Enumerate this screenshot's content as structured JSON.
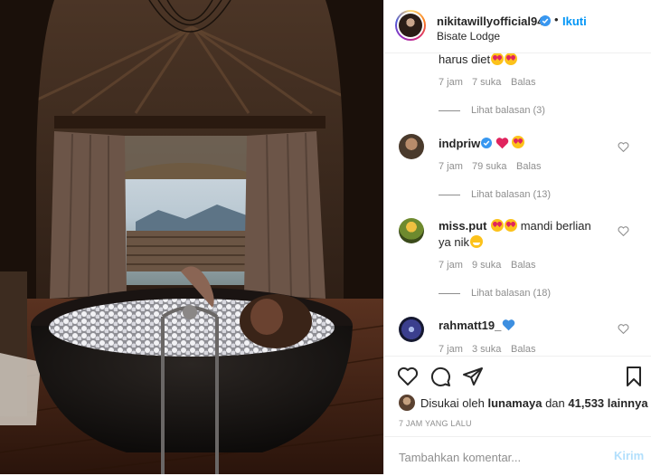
{
  "header": {
    "username": "nikitawillyofficial94",
    "dot": "•",
    "follow_label": "Ikuti",
    "location": "Bisate Lodge"
  },
  "comments": [
    {
      "text": "harus diet",
      "time": "7 jam",
      "likes": "7 suka",
      "reply_label": "Balas",
      "view_replies": "Lihat balasan (3)"
    },
    {
      "username": "indpriw",
      "verified": true,
      "time": "7 jam",
      "likes": "79 suka",
      "reply_label": "Balas",
      "view_replies": "Lihat balasan (13)"
    },
    {
      "username": "miss.put",
      "text": "mandi berlian",
      "text2": "ya nik",
      "time": "7 jam",
      "likes": "9 suka",
      "reply_label": "Balas",
      "view_replies": "Lihat balasan (18)"
    },
    {
      "username": "rahmatt19_",
      "time": "7 jam",
      "likes": "3 suka",
      "reply_label": "Balas"
    }
  ],
  "actions": {
    "liked_by_prefix": "Disukai oleh",
    "liked_by_user": "lunamaya",
    "liked_by_and": "dan",
    "liked_by_count": "41,533 lainnya",
    "timestamp": "7 JAM YANG LALU",
    "comment_placeholder": "Tambahkan komentar...",
    "post_label": "Kirim"
  },
  "icons": {
    "like": "heart-outline-icon",
    "comment": "speech-bubble-icon",
    "share": "paper-plane-icon",
    "save": "bookmark-icon",
    "verified": "verified-badge-icon",
    "comment_like": "small-heart-icon"
  },
  "colors": {
    "accent": "#0095f6",
    "muted": "#8e8e8e",
    "border": "#efefef",
    "post_disabled": "#b2dffc"
  }
}
